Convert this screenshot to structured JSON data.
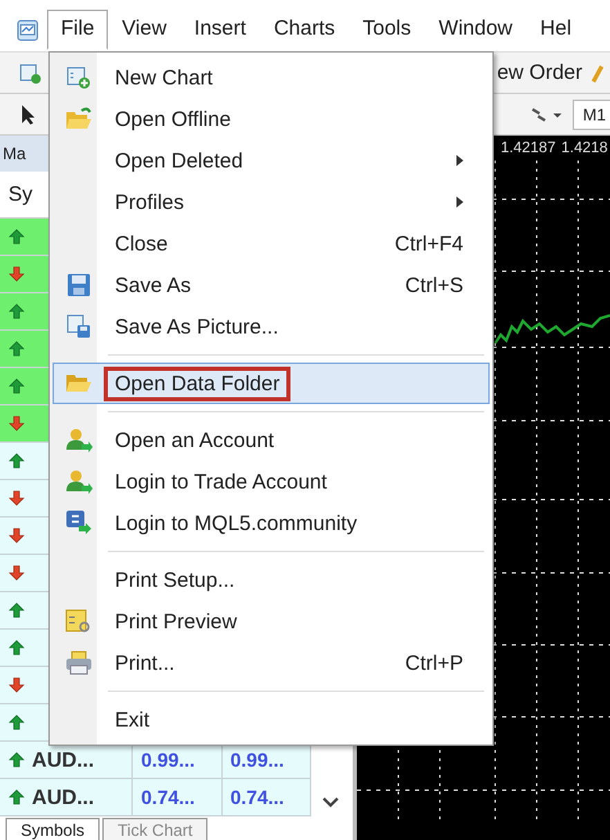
{
  "menu_bar": {
    "items": [
      {
        "label": "File",
        "selected": true
      },
      {
        "label": "View",
        "selected": false
      },
      {
        "label": "Insert",
        "selected": false
      },
      {
        "label": "Charts",
        "selected": false
      },
      {
        "label": "Tools",
        "selected": false
      },
      {
        "label": "Window",
        "selected": false
      },
      {
        "label": "Hel",
        "selected": false
      }
    ]
  },
  "toolbar": {
    "new_order": "ew Order",
    "timeframe": "M1"
  },
  "market_watch": {
    "title": "Ma",
    "column_1": "Sy",
    "rows": [
      {
        "rising": true,
        "highlighted": true
      },
      {
        "rising": false,
        "highlighted": true
      },
      {
        "rising": true,
        "highlighted": true
      },
      {
        "rising": true,
        "highlighted": true
      },
      {
        "rising": true,
        "highlighted": true
      },
      {
        "rising": false,
        "highlighted": true
      },
      {
        "rising": true,
        "highlighted": false
      },
      {
        "rising": false,
        "highlighted": false
      },
      {
        "rising": false,
        "highlighted": false
      },
      {
        "rising": false,
        "highlighted": false
      },
      {
        "rising": true,
        "highlighted": false
      },
      {
        "rising": true,
        "highlighted": false
      },
      {
        "rising": false,
        "highlighted": false
      },
      {
        "rising": true,
        "highlighted": false
      },
      {
        "rising": true,
        "highlighted": false,
        "symbol": "AUD...",
        "bid": "0.99...",
        "ask": "0.99..."
      },
      {
        "rising": true,
        "highlighted": false,
        "symbol": "AUD...",
        "bid": "0.74...",
        "ask": "0.74..."
      }
    ],
    "tabs": [
      {
        "label": "Symbols",
        "selected": true
      },
      {
        "label": "Tick Chart",
        "selected": false
      }
    ]
  },
  "chart": {
    "prices": [
      "1.42187",
      "1.4218"
    ]
  },
  "file_menu": {
    "items": [
      {
        "kind": "item",
        "label": "New Chart",
        "selected": false,
        "outlined": false
      },
      {
        "kind": "item",
        "label": "Open Offline",
        "selected": false,
        "outlined": false
      },
      {
        "kind": "item",
        "label": "Open Deleted",
        "submenu": true,
        "selected": false,
        "outlined": false
      },
      {
        "kind": "item",
        "label": "Profiles",
        "submenu": true,
        "selected": false,
        "outlined": false
      },
      {
        "kind": "item",
        "label": "Close",
        "shortcut": "Ctrl+F4",
        "selected": false,
        "outlined": false
      },
      {
        "kind": "item",
        "label": "Save As",
        "shortcut": "Ctrl+S",
        "selected": false,
        "outlined": false
      },
      {
        "kind": "item",
        "label": "Save As Picture...",
        "selected": false,
        "outlined": false
      },
      {
        "kind": "separator"
      },
      {
        "kind": "item",
        "label": "Open Data Folder",
        "selected": true,
        "outlined": true
      },
      {
        "kind": "separator"
      },
      {
        "kind": "item",
        "label": "Open an Account",
        "selected": false,
        "outlined": false
      },
      {
        "kind": "item",
        "label": "Login to Trade Account",
        "selected": false,
        "outlined": false
      },
      {
        "kind": "item",
        "label": "Login to MQL5.community",
        "selected": false,
        "outlined": false
      },
      {
        "kind": "separator"
      },
      {
        "kind": "item",
        "label": "Print Setup...",
        "selected": false,
        "outlined": false
      },
      {
        "kind": "item",
        "label": "Print Preview",
        "selected": false,
        "outlined": false
      },
      {
        "kind": "item",
        "label": "Print...",
        "shortcut": "Ctrl+P",
        "selected": false,
        "outlined": false
      },
      {
        "kind": "separator"
      },
      {
        "kind": "item",
        "label": "Exit",
        "selected": false,
        "outlined": false
      }
    ]
  }
}
